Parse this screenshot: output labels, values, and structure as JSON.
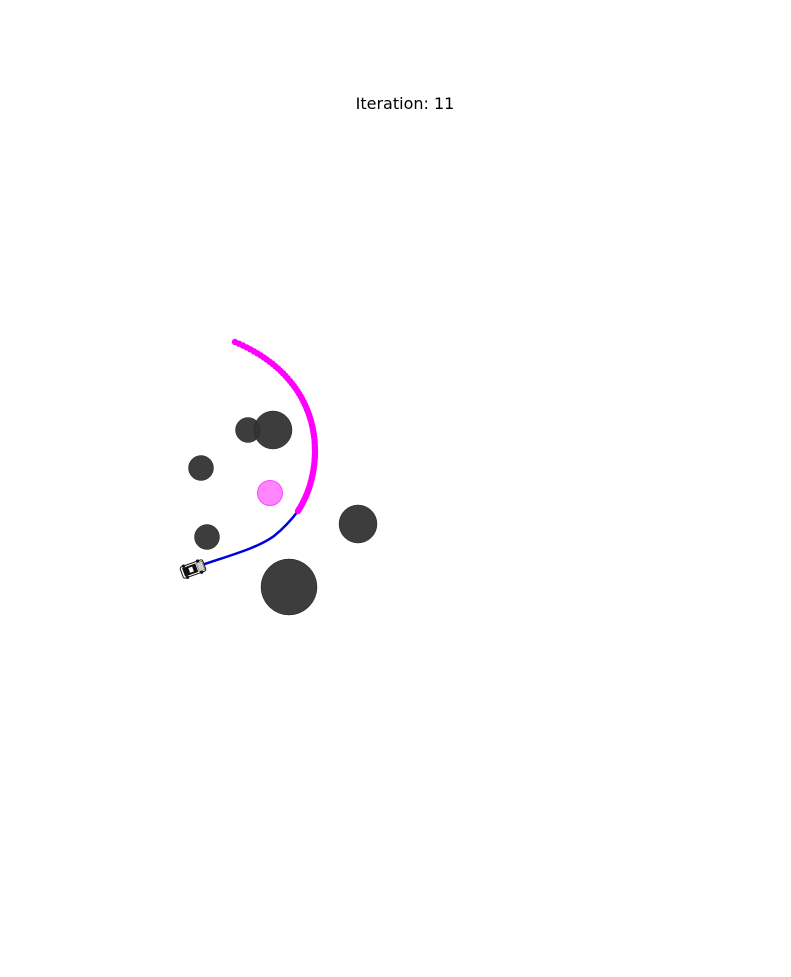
{
  "title": "Iteration: 11",
  "colors": {
    "obstacle": "#333333",
    "goal": "#ff66ff",
    "predicted_path": "#ff00ff",
    "traveled_path": "#0000dd",
    "vehicle_body": "#111111"
  },
  "icons": {
    "vehicle": "car-icon"
  }
}
